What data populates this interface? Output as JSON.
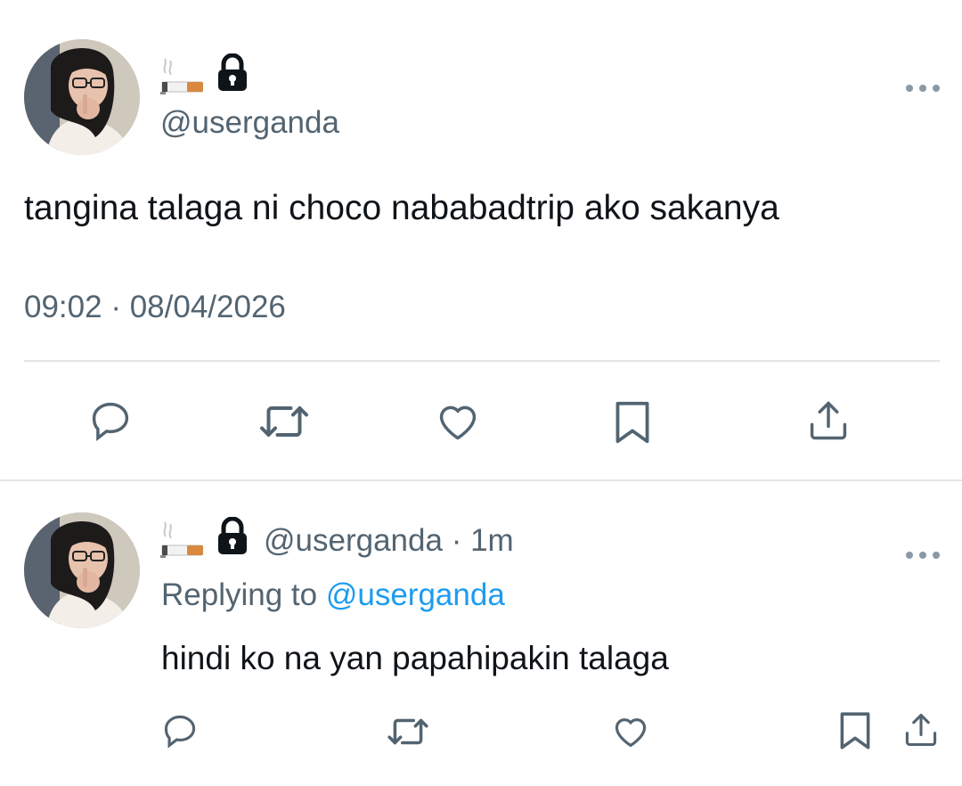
{
  "main_tweet": {
    "display_name_emoji": "cigarette",
    "handle": "@userganda",
    "text": "tangina talaga ni choco nababadtrip ako sakanya",
    "time": "09:02",
    "separator": "·",
    "date": "08/04/2026",
    "actions": [
      "reply-icon",
      "retweet-icon",
      "like-icon",
      "bookmark-icon",
      "share-icon"
    ]
  },
  "reply_tweet": {
    "display_name_emoji": "cigarette",
    "handle": "@userganda",
    "separator": "·",
    "age": "1m",
    "replying_prefix": "Replying to",
    "replying_handle": "@userganda",
    "text": "hindi ko na yan papahipakin talaga",
    "actions": [
      "reply-icon",
      "retweet-icon",
      "like-icon",
      "bookmark-icon",
      "share-icon"
    ]
  },
  "colors": {
    "text": "#0f1419",
    "muted": "#536471",
    "link": "#1d9bf0",
    "icon": "#536471",
    "divider": "#e3e6e8"
  }
}
